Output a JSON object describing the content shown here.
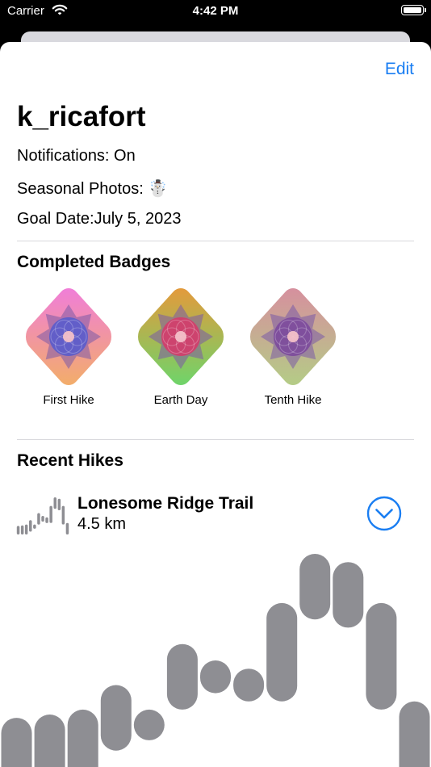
{
  "status_bar": {
    "carrier": "Carrier",
    "time": "4:42 PM"
  },
  "header": {
    "edit_label": "Edit"
  },
  "profile": {
    "username": "k_ricafort",
    "notifications": "Notifications: On",
    "seasonal_photos": "Seasonal Photos: ☃️",
    "goal_date": "Goal Date:July 5, 2023"
  },
  "badges": {
    "title": "Completed Badges",
    "items": [
      {
        "label": "First Hike",
        "top_color": "#f07ed8",
        "bottom_color": "#f2ad6a",
        "center_color": "#5a5ccc",
        "icon": "badge-first-hike"
      },
      {
        "label": "Earth Day",
        "top_color": "#e39a3c",
        "bottom_color": "#6fd46a",
        "center_color": "#d43c6c",
        "icon": "badge-earth-day"
      },
      {
        "label": "Tenth Hike",
        "top_color": "#d6909e",
        "bottom_color": "#b4cc86",
        "center_color": "#7c4a9c",
        "icon": "badge-tenth-hike"
      }
    ]
  },
  "recent_hikes": {
    "title": "Recent Hikes",
    "hike": {
      "name": "Lonesome Ridge Trail",
      "distance": "4.5 km",
      "elevation_ranges": [
        [
          0,
          0.3
        ],
        [
          0,
          0.32
        ],
        [
          0,
          0.35
        ],
        [
          0.1,
          0.5
        ],
        [
          0.2,
          0.35
        ],
        [
          0.35,
          0.75
        ],
        [
          0.45,
          0.65
        ],
        [
          0.4,
          0.6
        ],
        [
          0.4,
          1.0
        ],
        [
          0.9,
          1.3
        ],
        [
          0.85,
          1.25
        ],
        [
          0.35,
          1.0
        ],
        [
          0,
          0.4
        ]
      ],
      "toggle_icon": "chevron-down-circle-icon"
    }
  },
  "colors": {
    "accent": "#1a7ef2",
    "graph": "#8e8e93"
  }
}
